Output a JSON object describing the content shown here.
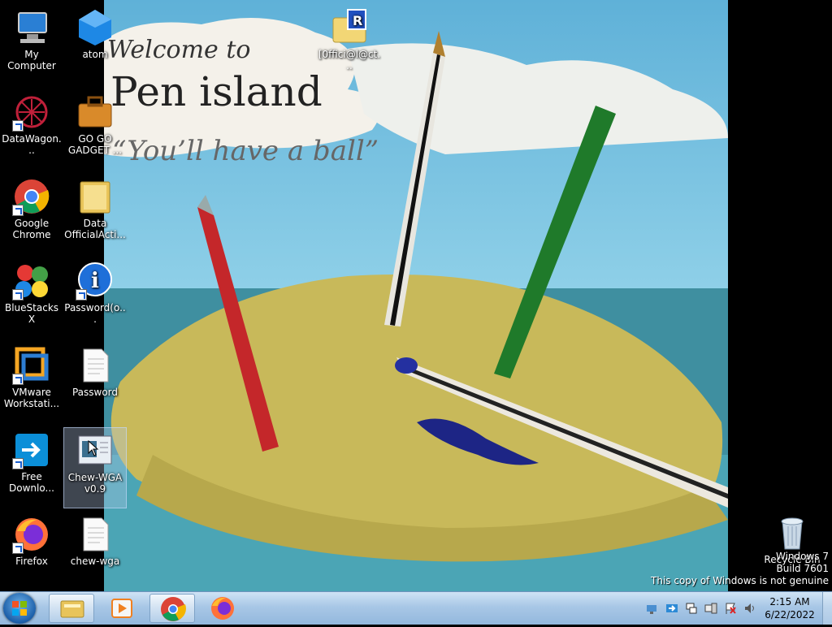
{
  "wallpaper": {
    "line1": "Welcome to",
    "line2": "Pen island",
    "line3": "“You’ll have a ball”"
  },
  "desktop_icons": [
    {
      "label": "My Computer",
      "icon": "computer-icon"
    },
    {
      "label": "atom",
      "icon": "atom-icon"
    },
    {
      "label": "[0ffici@l@ct...",
      "icon": "winrar-folder-icon"
    },
    {
      "label": "DataWagon...",
      "icon": "datawagon-icon"
    },
    {
      "label": "GO GO GADGET ...",
      "icon": "briefcase-icon"
    },
    {
      "label": "Google Chrome",
      "icon": "chrome-icon"
    },
    {
      "label": "Data OfficialActi...",
      "icon": "folder-icon"
    },
    {
      "label": "BlueStacks X",
      "icon": "bluestacks-icon"
    },
    {
      "label": "Password(o...",
      "icon": "info-icon"
    },
    {
      "label": "VMware Workstati...",
      "icon": "vmware-icon"
    },
    {
      "label": "Password",
      "icon": "text-file-icon"
    },
    {
      "label": "Free Downlo...",
      "icon": "download-manager-icon"
    },
    {
      "label": "Chew-WGA v0.9",
      "icon": "chew-wga-icon"
    },
    {
      "label": "Firefox",
      "icon": "firefox-icon"
    },
    {
      "label": "chew-wga",
      "icon": "text-file-icon"
    },
    {
      "label": "Recycle Bin",
      "icon": "recycle-bin-icon"
    }
  ],
  "watermark": {
    "line1": "Windows 7",
    "line2": "Build 7601",
    "line3": "This copy of Windows is not genuine"
  },
  "taskbar": {
    "apps": [
      "file-explorer",
      "media-player",
      "google-chrome",
      "firefox"
    ],
    "active": "google-chrome",
    "tray_icons": [
      "network-icon",
      "action-center-icon",
      "display-icon",
      "device-icon",
      "flag-icon",
      "volume-icon"
    ]
  },
  "clock": {
    "time": "2:15 AM",
    "date": "6/22/2022"
  }
}
